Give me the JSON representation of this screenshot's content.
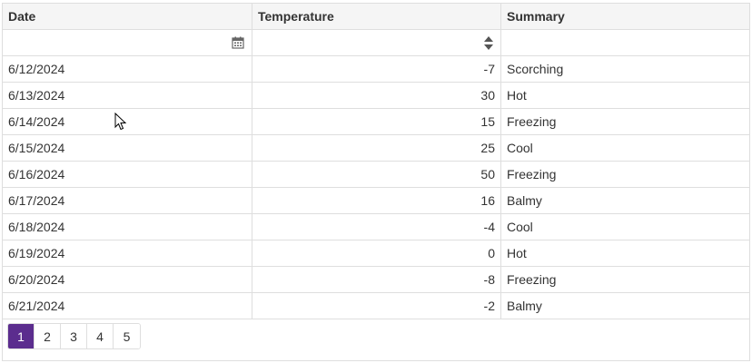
{
  "grid": {
    "columns": [
      "Date",
      "Temperature",
      "Summary"
    ],
    "rows": [
      {
        "date": "6/12/2024",
        "temperature": "-7",
        "summary": "Scorching"
      },
      {
        "date": "6/13/2024",
        "temperature": "30",
        "summary": "Hot"
      },
      {
        "date": "6/14/2024",
        "temperature": "15",
        "summary": "Freezing"
      },
      {
        "date": "6/15/2024",
        "temperature": "25",
        "summary": "Cool"
      },
      {
        "date": "6/16/2024",
        "temperature": "50",
        "summary": "Freezing"
      },
      {
        "date": "6/17/2024",
        "temperature": "16",
        "summary": "Balmy"
      },
      {
        "date": "6/18/2024",
        "temperature": "-4",
        "summary": "Cool"
      },
      {
        "date": "6/19/2024",
        "temperature": "0",
        "summary": "Hot"
      },
      {
        "date": "6/20/2024",
        "temperature": "-8",
        "summary": "Freezing"
      },
      {
        "date": "6/21/2024",
        "temperature": "-2",
        "summary": "Balmy"
      }
    ]
  },
  "filters": {
    "date_value": "",
    "temperature_value": "",
    "summary_value": "",
    "date_icon": "calendar-icon",
    "temperature_icon": "spinner-arrows-icon"
  },
  "pager": {
    "pages": [
      "1",
      "2",
      "3",
      "4",
      "5"
    ],
    "current": "1"
  },
  "colors": {
    "accent": "#5b2d8e",
    "border": "#dedede",
    "header_bg": "#f5f5f5",
    "text": "#333333"
  }
}
